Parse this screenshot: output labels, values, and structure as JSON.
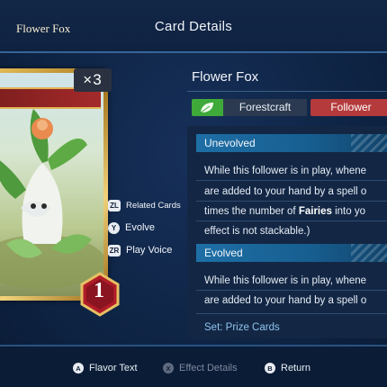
{
  "header": {
    "title": "Card Details"
  },
  "card": {
    "name": "Flower Fox",
    "count": "×3",
    "cost": "1",
    "craft": "Forestcraft",
    "type": "Follower"
  },
  "menu": [
    {
      "button": "ZL",
      "label": "Related Cards"
    },
    {
      "button": "Y",
      "label": "Evolve"
    },
    {
      "button": "ZR",
      "label": "Play Voice"
    }
  ],
  "effects": {
    "unevolved_label": "Unevolved",
    "unevolved_lines": [
      "While this follower is in play, whene",
      "are added to your hand by a spell o",
      "times the number of |Fairies| into yo",
      "effect is not stackable.)"
    ],
    "evolved_label": "Evolved",
    "evolved_lines": [
      "While this follower is in play, whene",
      "are added to your hand by a spell o"
    ],
    "set": "Set: Prize Cards"
  },
  "footer": [
    {
      "button": "A",
      "label": "Flavor Text",
      "enabled": true
    },
    {
      "button": "X",
      "label": "Effect Details",
      "enabled": false
    },
    {
      "button": "B",
      "label": "Return",
      "enabled": true
    }
  ],
  "colors": {
    "background": "#0f2546",
    "stripe": "#1e6fa6",
    "craft_green": "#3faa3a",
    "follower_red": "#b43a3c",
    "set_text": "#8fc4ec"
  }
}
